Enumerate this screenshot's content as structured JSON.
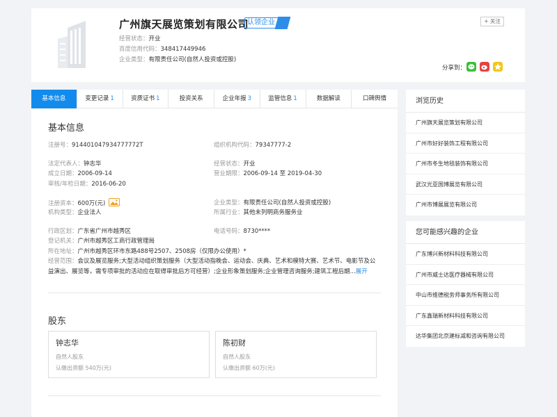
{
  "company": {
    "name": "广州旗天展览策划有限公司",
    "badge": "认领企业",
    "status_label": "经营状态：",
    "status_value": "开业",
    "credit_label": "百度信用代码：",
    "credit_value": "348417449946",
    "type_label": "企业类型：",
    "type_value": "有限责任公司(自然人投资或控股)",
    "follow": "+ 关注",
    "share_label": "分享到："
  },
  "tabs": [
    {
      "label": "基本信息",
      "num": ""
    },
    {
      "label": "变更记录",
      "num": "1"
    },
    {
      "label": "资质证书",
      "num": "1"
    },
    {
      "label": "投资关系",
      "num": ""
    },
    {
      "label": "企业年报",
      "num": "3"
    },
    {
      "label": "监管信息",
      "num": "1"
    },
    {
      "label": "数据解读",
      "num": ""
    },
    {
      "label": "口碑舆情",
      "num": ""
    }
  ],
  "basic": {
    "title": "基本信息",
    "reg_no_k": "注册号：",
    "reg_no_v": "914401047934777772T",
    "org_code_k": "组织机构代码：",
    "org_code_v": "79347777-2",
    "legal_k": "法定代表人：",
    "legal_v": "钟志华",
    "status_k": "经营状态：",
    "status_v": "开业",
    "est_k": "成立日期：",
    "est_v": "2006-09-14",
    "term_k": "营业期限：",
    "term_v": "2006-09-14 至 2019-04-30",
    "audit_k": "审核/年检日期：",
    "audit_v": "2016-06-20",
    "capital_k": "注册资本：",
    "capital_v": "600万(元)",
    "etype_k": "企业类型：",
    "etype_v": "有限责任公司(自然人投资或控股)",
    "org_type_k": "机构类型：",
    "org_type_v": "企业法人",
    "industry_k": "所属行业：",
    "industry_v": "其他未列明商务服务业",
    "region_k": "行政区划：",
    "region_v": "广东省广州市越秀区",
    "phone_k": "电话号码：",
    "phone_v": "8730****",
    "authority_k": "登记机关：",
    "authority_v": "广州市越秀区工商行政管理局",
    "address_k": "所在地址：",
    "address_v": "广州市越秀区环市东路488号2507、2508房（仅限办公使用）*",
    "scope_k": "经营范围：",
    "scope_v": "会议及展览服务;大型活动组织策划服务（大型活动指晚会、运动会、庆典、艺术和模特大赛、艺术节、电影节及公益演出、展览等，需专项审批的活动应在取得审批后方可经营）;企业形象策划服务;企业管理咨询服务;建筑工程后期...",
    "expand": "展开"
  },
  "shareholders": {
    "title": "股东",
    "items": [
      {
        "name": "钟志华",
        "type": "自然人股东",
        "amount": "认缴出资额 540万(元)"
      },
      {
        "name": "陈初财",
        "type": "自然人股东",
        "amount": "认缴出资额 60万(元)"
      }
    ]
  },
  "history": {
    "title": "浏览历史",
    "items": [
      "广州旗天展览策划有限公司",
      "广州市好好装饰工程有限公司",
      "广州市冬生地毯装饰有限公司",
      "武汉光亚国博展览有限公司",
      "广州市博展展览有限公司"
    ]
  },
  "interest": {
    "title": "您可能感兴趣的企业",
    "items": [
      "广东博兴新材料科技有限公司",
      "广州市威士达医疗器械有限公司",
      "中山市维德税务师事务所有限公司",
      "广东鑫瑞新材料科技有限公司",
      "达华集团北京建标减和咨询有限公司"
    ]
  },
  "colors": {
    "accent": "#128bed",
    "link": "#2e8de8",
    "wechat": "#3bbf3b",
    "weibo": "#e64141",
    "qzone": "#f5c518"
  }
}
